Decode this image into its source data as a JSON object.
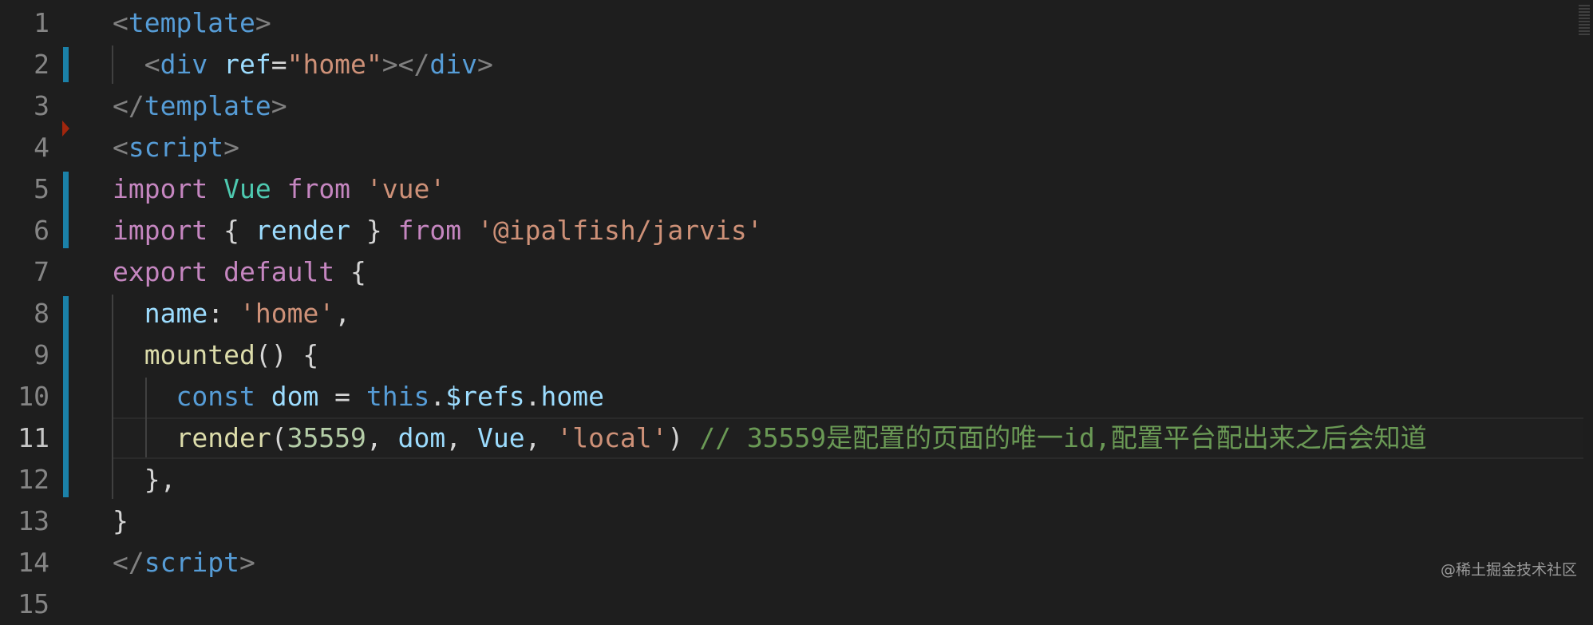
{
  "editor": {
    "active_line": 11,
    "lines": [
      {
        "number": "1",
        "tokens": [
          {
            "t": "<",
            "c": "punc"
          },
          {
            "t": "template",
            "c": "tag"
          },
          {
            "t": ">",
            "c": "punc"
          }
        ]
      },
      {
        "number": "2",
        "tokens": [
          {
            "t": "  <",
            "c": "punc"
          },
          {
            "t": "div",
            "c": "tag"
          },
          {
            "t": " ",
            "c": "plain"
          },
          {
            "t": "ref",
            "c": "attr"
          },
          {
            "t": "=",
            "c": "plain"
          },
          {
            "t": "\"home\"",
            "c": "str"
          },
          {
            "t": "></",
            "c": "punc"
          },
          {
            "t": "div",
            "c": "tag"
          },
          {
            "t": ">",
            "c": "punc"
          }
        ]
      },
      {
        "number": "3",
        "tokens": [
          {
            "t": "</",
            "c": "punc"
          },
          {
            "t": "template",
            "c": "tag"
          },
          {
            "t": ">",
            "c": "punc"
          }
        ]
      },
      {
        "number": "4",
        "tokens": [
          {
            "t": "<",
            "c": "punc"
          },
          {
            "t": "script",
            "c": "tag"
          },
          {
            "t": ">",
            "c": "punc"
          }
        ]
      },
      {
        "number": "5",
        "tokens": [
          {
            "t": "import",
            "c": "kw"
          },
          {
            "t": " ",
            "c": "plain"
          },
          {
            "t": "Vue",
            "c": "cls"
          },
          {
            "t": " ",
            "c": "plain"
          },
          {
            "t": "from",
            "c": "kw"
          },
          {
            "t": " ",
            "c": "plain"
          },
          {
            "t": "'vue'",
            "c": "str"
          }
        ]
      },
      {
        "number": "6",
        "tokens": [
          {
            "t": "import",
            "c": "kw"
          },
          {
            "t": " { ",
            "c": "plain"
          },
          {
            "t": "render",
            "c": "var"
          },
          {
            "t": " } ",
            "c": "plain"
          },
          {
            "t": "from",
            "c": "kw"
          },
          {
            "t": " ",
            "c": "plain"
          },
          {
            "t": "'@ipalfish/jarvis'",
            "c": "str"
          }
        ]
      },
      {
        "number": "7",
        "tokens": [
          {
            "t": "export",
            "c": "kw"
          },
          {
            "t": " ",
            "c": "plain"
          },
          {
            "t": "default",
            "c": "kw"
          },
          {
            "t": " {",
            "c": "plain"
          }
        ]
      },
      {
        "number": "8",
        "tokens": [
          {
            "t": "  ",
            "c": "plain"
          },
          {
            "t": "name",
            "c": "var"
          },
          {
            "t": ": ",
            "c": "plain"
          },
          {
            "t": "'home'",
            "c": "str"
          },
          {
            "t": ",",
            "c": "plain"
          }
        ]
      },
      {
        "number": "9",
        "tokens": [
          {
            "t": "  ",
            "c": "plain"
          },
          {
            "t": "mounted",
            "c": "fn"
          },
          {
            "t": "() {",
            "c": "plain"
          }
        ]
      },
      {
        "number": "10",
        "tokens": [
          {
            "t": "    ",
            "c": "plain"
          },
          {
            "t": "const",
            "c": "const"
          },
          {
            "t": " ",
            "c": "plain"
          },
          {
            "t": "dom",
            "c": "var"
          },
          {
            "t": " = ",
            "c": "plain"
          },
          {
            "t": "this",
            "c": "const"
          },
          {
            "t": ".",
            "c": "plain"
          },
          {
            "t": "$refs",
            "c": "var"
          },
          {
            "t": ".",
            "c": "plain"
          },
          {
            "t": "home",
            "c": "var"
          }
        ]
      },
      {
        "number": "11",
        "tokens": [
          {
            "t": "    ",
            "c": "plain"
          },
          {
            "t": "render",
            "c": "fn"
          },
          {
            "t": "(",
            "c": "plain"
          },
          {
            "t": "35559",
            "c": "num-lit"
          },
          {
            "t": ", ",
            "c": "plain"
          },
          {
            "t": "dom",
            "c": "var"
          },
          {
            "t": ", ",
            "c": "plain"
          },
          {
            "t": "Vue",
            "c": "var"
          },
          {
            "t": ", ",
            "c": "plain"
          },
          {
            "t": "'local'",
            "c": "str"
          },
          {
            "t": ") ",
            "c": "plain"
          },
          {
            "t": "// 35559是配置的页面的唯一id,配置平台配出来之后会知道",
            "c": "cmt"
          }
        ]
      },
      {
        "number": "12",
        "tokens": [
          {
            "t": "  },",
            "c": "plain"
          }
        ]
      },
      {
        "number": "13",
        "tokens": [
          {
            "t": "}",
            "c": "plain"
          }
        ]
      },
      {
        "number": "14",
        "tokens": [
          {
            "t": "</",
            "c": "punc"
          },
          {
            "t": "script",
            "c": "tag"
          },
          {
            "t": ">",
            "c": "punc"
          }
        ]
      },
      {
        "number": "15",
        "tokens": []
      }
    ],
    "gutter_modified_ranges": [
      [
        2,
        2
      ],
      [
        5,
        6
      ],
      [
        8,
        12
      ]
    ]
  },
  "colors": {
    "background": "#1e1e1e",
    "gutter_modified": "#1b81a8",
    "breakpoint_arrow": "#a1260d"
  },
  "watermark": "@稀土掘金技术社区"
}
